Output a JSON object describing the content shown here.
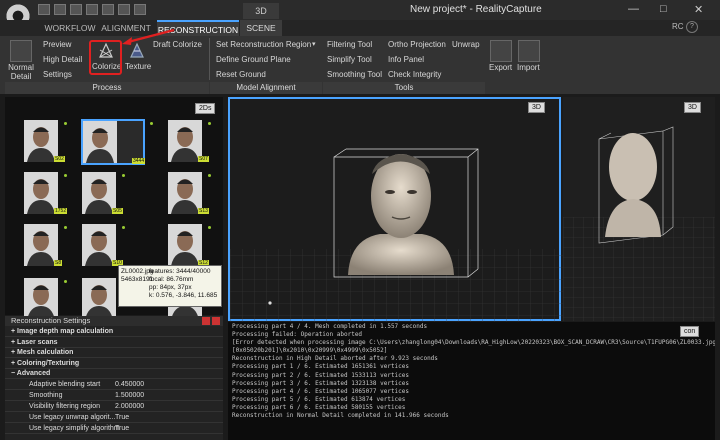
{
  "window": {
    "mode_tab": "3D",
    "title": "New project* - RealityCapture",
    "controls": [
      "—",
      "□",
      "✕"
    ]
  },
  "tabs": [
    {
      "label": "WORKFLOW"
    },
    {
      "label": "ALIGNMENT"
    },
    {
      "label": "RECONSTRUCTION"
    },
    {
      "label": "SCENE"
    }
  ],
  "user": "RC",
  "ribbon": {
    "normal_detail": "Normal\nDetail",
    "preview": "Preview",
    "high_detail": "High Detail",
    "settings": "Settings",
    "colorize": "Colorize",
    "texture": "Texture",
    "draft_colorize": "Draft Colorize",
    "set_region": "Set Reconstruction Region",
    "define_ground": "Define Ground Plane",
    "reset_ground": "Reset Ground",
    "filtering": "Filtering Tool",
    "simplify": "Simplify Tool",
    "smoothing": "Smoothing Tool",
    "ortho": "Ortho Projection",
    "unwrap": "Unwrap",
    "info_panel": "Info Panel",
    "check_integrity": "Check Integrity",
    "export": "Export",
    "import": "Import",
    "groups": {
      "process": "Process",
      "model_alignment": "Model Alignment",
      "tools": "Tools"
    }
  },
  "panel2d": {
    "badge": "2Ds",
    "thumbs": [
      {
        "label": "S02"
      },
      {
        "label": "3444"
      },
      {
        "label": "S07"
      },
      {
        "label": "1752"
      },
      {
        "label": "S05"
      },
      {
        "label": "S13"
      },
      {
        "label": "S8"
      },
      {
        "label": "S10"
      },
      {
        "label": "S12"
      },
      {
        "label": ""
      },
      {
        "label": ""
      },
      {
        "label": ""
      }
    ],
    "tooltip": {
      "name": "ZL0002.jpg",
      "size": "5463x8191",
      "features": "features: 3444/40000",
      "focal": "focal: 86.76mm",
      "pp": "pp: 84px, 37px",
      "k": "k: 0.576, -3.846, 11.685"
    }
  },
  "settings": {
    "title": "Reconstruction Settings",
    "sections": [
      "Image depth map calculation",
      "Laser scans",
      "Mesh calculation",
      "Coloring/Texturing",
      "Advanced"
    ],
    "rows": [
      {
        "name": "Adaptive blending start",
        "value": "0.450000"
      },
      {
        "name": "Smoothing",
        "value": "1.500000"
      },
      {
        "name": "Visibility filtering region",
        "value": "2.000000"
      },
      {
        "name": "Use legacy unwrap algorit...",
        "value": "True"
      },
      {
        "name": "Use legacy simplify algorithm",
        "value": "True"
      }
    ]
  },
  "view3d": {
    "badge": "3D"
  },
  "view3d_right": {
    "badge": "3D"
  },
  "console": {
    "badge": "con",
    "lines": [
      "Processing part 4 / 4. Mesh completed in 1.557 seconds",
      "Processing failed: Operation aborted",
      "   [Error detected when processing image C:\\Users\\zhanglong04\\Downloads\\RA_HighLow\\20220323\\BOX_SCAN_DCRAW\\CR3\\Source\\T1FUPG06\\ZL0033.jpg$ on GPU.]",
      "   [0x05020b201]\\0x2010\\0x20999\\0x4999\\0x5052]",
      "Reconstruction in High Detail aborted after 9.923 seconds",
      "Processing part 1 / 6. Estimated 1651361 vertices",
      "Processing part 2 / 6. Estimated 1533113 vertices",
      "Processing part 3 / 6. Estimated 1323138 vertices",
      "Processing part 4 / 6. Estimated 1065077 vertices",
      "Processing part 5 / 6. Estimated 613874 vertices",
      "Processing part 6 / 6. Estimated 580155 vertices",
      "Reconstruction in Normal Detail completed in 141.966 seconds"
    ]
  },
  "colors": {
    "accent": "#4aa3ff",
    "highlight": "#e02020",
    "thumb_label": "#ccdd33"
  }
}
